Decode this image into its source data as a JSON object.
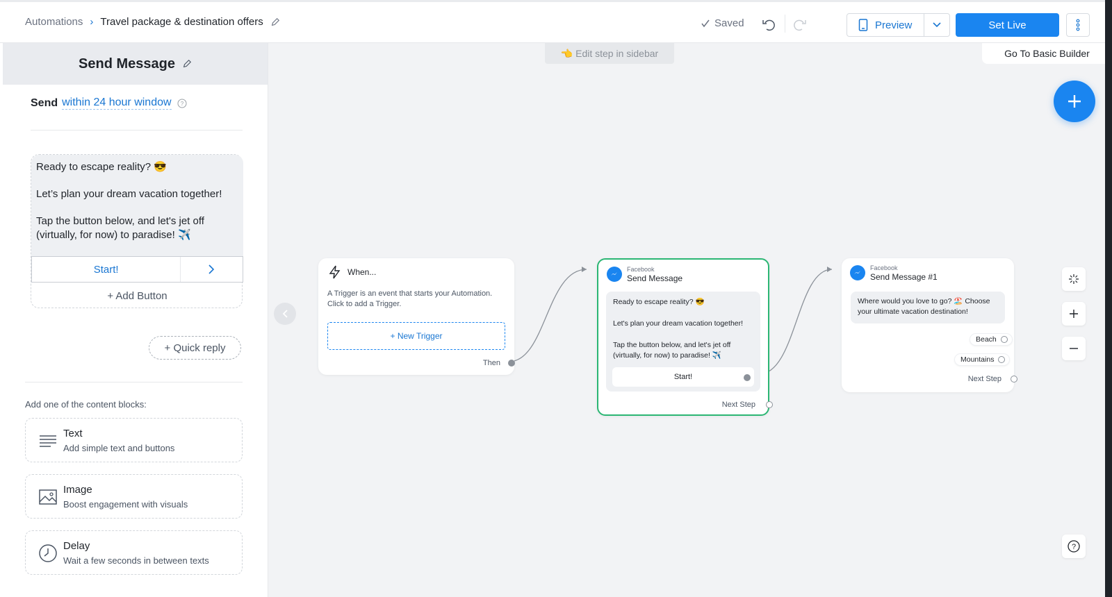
{
  "breadcrumb": {
    "root": "Automations",
    "current": "Travel package & destination offers"
  },
  "toolbar": {
    "saved_label": "Saved",
    "preview_label": "Preview",
    "set_live_label": "Set Live"
  },
  "sidebar": {
    "title": "Send Message",
    "send_label": "Send",
    "send_window": "within 24 hour window",
    "message_lines": [
      "Ready to escape reality? 😎",
      "Let’s plan your dream vacation together!",
      "Tap the button below, and let's jet off (virtually, for now) to paradise! ✈️"
    ],
    "button_label": "Start!",
    "add_button_label": "+ Add Button",
    "quick_reply_label": "+ Quick reply",
    "content_blocks_title": "Add one of the content blocks:",
    "blocks": [
      {
        "title": "Text",
        "subtitle": "Add simple text and buttons",
        "icon": "text-lines-icon"
      },
      {
        "title": "Image",
        "subtitle": "Boost engagement with visuals",
        "icon": "image-icon"
      },
      {
        "title": "Delay",
        "subtitle": "Wait a few seconds in between texts",
        "icon": "clock-icon"
      }
    ]
  },
  "canvas": {
    "edit_hint": "👈 Edit step in sidebar",
    "basic_builder_label": "Go To Basic Builder",
    "trigger_node": {
      "title": "When...",
      "description": "A Trigger is an event that starts your Automation. Click to add a Trigger.",
      "new_trigger_label": "+ New Trigger",
      "then_label": "Then"
    },
    "message_node": {
      "channel": "Facebook",
      "title": "Send Message",
      "lines": [
        "Ready to escape reality? 😎",
        "Let's plan your dream vacation together!",
        "Tap the button below, and let's jet off (virtually, for now) to paradise! ✈️"
      ],
      "button_label": "Start!",
      "next_step_label": "Next Step"
    },
    "message_node_2": {
      "channel": "Facebook",
      "title": "Send Message #1",
      "text": "Where would you love to go? 🏖️ Choose your ultimate vacation destination!",
      "quick_replies": [
        "Beach",
        "Mountains"
      ],
      "next_step_label": "Next Step"
    }
  },
  "colors": {
    "accent": "#1a85f0",
    "selected_node_border": "#2bb673",
    "canvas_bg": "#f2f3f5"
  }
}
